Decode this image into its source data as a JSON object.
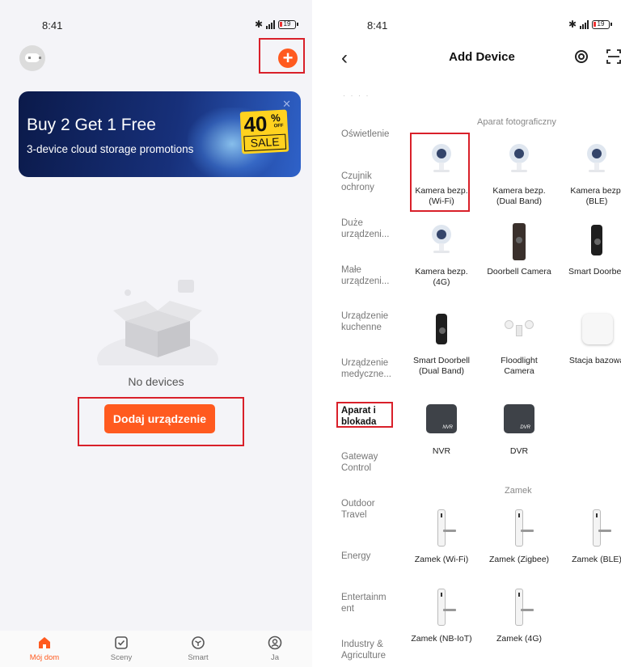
{
  "left": {
    "status": {
      "time": "8:41",
      "battery": "19"
    },
    "banner": {
      "headline": "Buy 2 Get 1 Free",
      "subline": "3-device cloud storage promotions",
      "badge_percent": "40",
      "badge_percent_sign": "%",
      "badge_off": "OFF",
      "badge_sale": "SALE"
    },
    "empty_text": "No devices",
    "add_button_label": "Dodaj urządzenie",
    "tabs": [
      {
        "label": "Mój dom",
        "icon": "home-icon",
        "active": true
      },
      {
        "label": "Sceny",
        "icon": "check-square-icon",
        "active": false
      },
      {
        "label": "Smart",
        "icon": "cube-icon",
        "active": false
      },
      {
        "label": "Ja",
        "icon": "user-icon",
        "active": false
      }
    ],
    "accent_color": "#ff5a1f"
  },
  "right": {
    "status": {
      "time": "8:41",
      "battery": "19"
    },
    "title": "Add Device",
    "categories": [
      {
        "label": "Oświetlenie"
      },
      {
        "label": "Czujnik ochrony"
      },
      {
        "label": "Duże urządzeni..."
      },
      {
        "label": "Małe urządzeni..."
      },
      {
        "label": "Urządzenie kuchenne"
      },
      {
        "label": "Urządzenie medyczne..."
      },
      {
        "label": "Aparat i blokada",
        "active": true
      },
      {
        "label": "Gateway Control"
      },
      {
        "label": "Outdoor Travel"
      },
      {
        "label": "Energy"
      },
      {
        "label": "Entertainm ent"
      },
      {
        "label": "Industry & Agriculture"
      }
    ],
    "section_camera": "Aparat fotograficzny",
    "section_lock": "Zamek",
    "devices": [
      {
        "label": "Kamera bezp. (Wi-Fi)",
        "icon": "camera-icon"
      },
      {
        "label": "Kamera bezp. (Dual Band)",
        "icon": "camera-icon"
      },
      {
        "label": "Kamera bezp. (BLE)",
        "icon": "camera-icon"
      },
      {
        "label": "Kamera bezp. (4G)",
        "icon": "camera-icon"
      },
      {
        "label": "Doorbell Camera",
        "icon": "doorbell-icon"
      },
      {
        "label": "Smart Doorbell",
        "icon": "doorbell-icon"
      },
      {
        "label": "Smart Doorbell (Dual Band)",
        "icon": "doorbell-icon"
      },
      {
        "label": "Floodlight Camera",
        "icon": "floodlight-icon"
      },
      {
        "label": "Stacja bazowa",
        "icon": "hub-icon"
      },
      {
        "label": "NVR",
        "icon": "nvr-icon",
        "badge": "NVR"
      },
      {
        "label": "DVR",
        "icon": "dvr-icon",
        "badge": "DVR"
      },
      {
        "label": "Zamek (Wi-Fi)",
        "icon": "lock-icon"
      },
      {
        "label": "Zamek (Zigbee)",
        "icon": "lock-icon"
      },
      {
        "label": "Zamek (BLE)",
        "icon": "lock-icon"
      },
      {
        "label": "Zamek (NB-IoT)",
        "icon": "lock-icon"
      },
      {
        "label": "Zamek (4G)",
        "icon": "lock-icon"
      }
    ]
  }
}
